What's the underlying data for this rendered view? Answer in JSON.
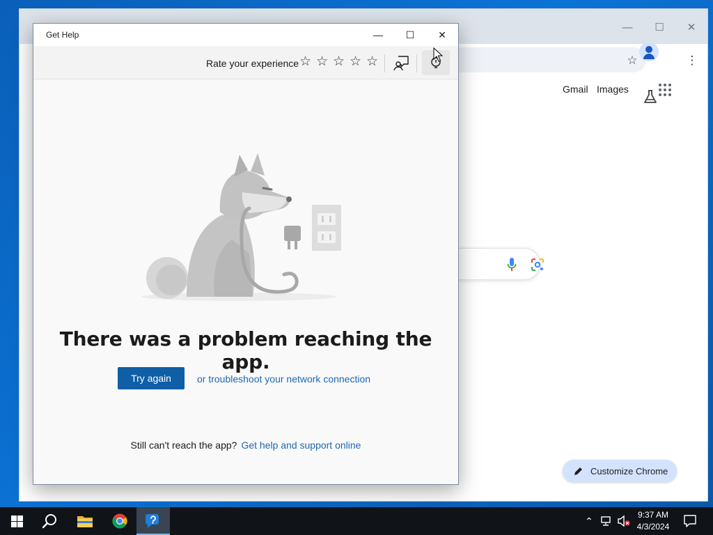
{
  "chrome": {
    "gmail_label": "Gmail",
    "images_label": "Images",
    "customize_label": "Customize Chrome",
    "caption": {
      "minimize": "—",
      "maximize": "☐",
      "close": "✕"
    }
  },
  "help": {
    "title": "Get Help",
    "caption": {
      "minimize": "—",
      "maximize": "☐",
      "close": "✕"
    },
    "rate_label": "Rate your experience",
    "stars": [
      "☆",
      "☆",
      "☆",
      "☆",
      "☆"
    ],
    "error_heading": "There was a problem reaching the app.",
    "try_again_label": "Try again",
    "troubleshoot_link": "or troubleshoot your network connection",
    "still_cant_text": "Still can't reach the app?",
    "support_link": "Get help and support online"
  },
  "taskbar": {
    "time": "9:37 AM",
    "date": "4/3/2024",
    "tray_up_arrow": "⌃"
  },
  "colors": {
    "accent_button": "#0f5ea6",
    "link": "#1d68b2",
    "taskbar": "#101418"
  }
}
